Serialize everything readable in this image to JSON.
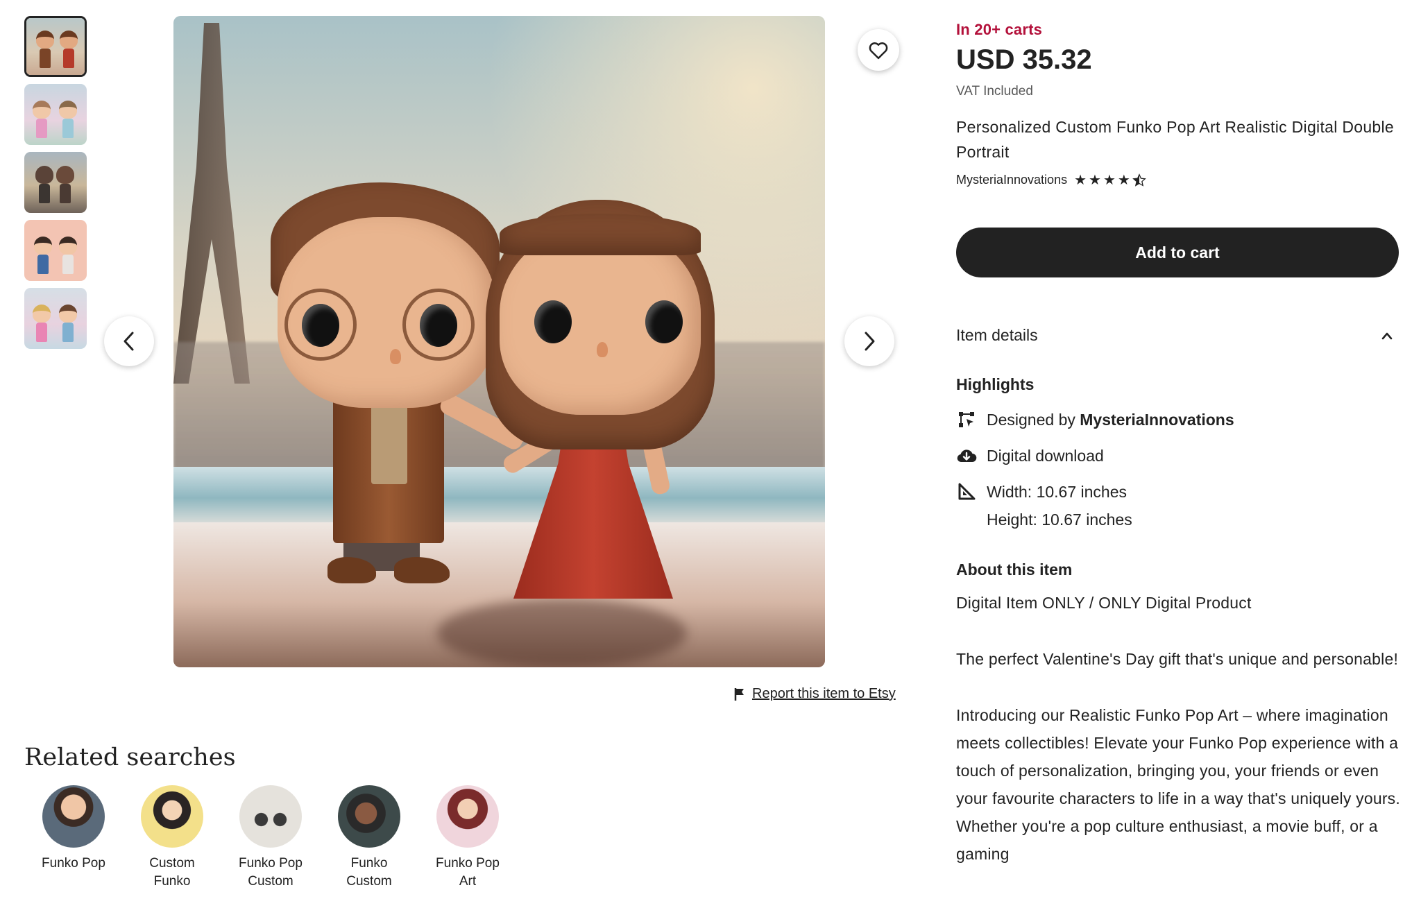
{
  "thumbnails": [
    {
      "active": true
    },
    {
      "active": false
    },
    {
      "active": false
    },
    {
      "active": false
    },
    {
      "active": false
    }
  ],
  "main_image": {
    "favorite_icon": "heart-outline-icon",
    "prev_icon": "chevron-left-icon",
    "next_icon": "chevron-right-icon"
  },
  "report": {
    "icon": "flag-icon",
    "label": "Report this item to Etsy"
  },
  "related": {
    "title": "Related searches",
    "items": [
      {
        "label": "Funko Pop"
      },
      {
        "label": "Custom Funko"
      },
      {
        "label": "Funko Pop Custom"
      },
      {
        "label": "Funko Custom"
      },
      {
        "label": "Funko Pop Art"
      }
    ]
  },
  "product": {
    "in_carts": "In 20+ carts",
    "price": "USD 35.32",
    "vat": "VAT Included",
    "title": "Personalized Custom Funko Pop Art Realistic Digital Double Portrait",
    "shop": "MysteriaInnovations",
    "rating": 4.5,
    "add_to_cart": "Add to cart"
  },
  "details": {
    "heading": "Item details",
    "highlights_heading": "Highlights",
    "designed_by_prefix": "Designed by",
    "designed_by_shop": "MysteriaInnovations",
    "digital_download": "Digital download",
    "width": "Width: 10.67 inches",
    "height": "Height: 10.67 inches",
    "about_heading": "About this item",
    "about_line1": "Digital Item ONLY / ONLY Digital Product",
    "about_line2": "The perfect Valentine's Day gift that's unique and personable!",
    "about_line3": "Introducing our Realistic Funko Pop Art – where imagination meets collectibles! Elevate your Funko Pop experience with a touch of personalization, bringing you, your friends or even your favourite characters to life in a way that's uniquely yours. Whether you're a pop culture enthusiast, a movie buff, or a gaming"
  },
  "colors": {
    "accent_red": "#b3103a",
    "button_dark": "#222222"
  }
}
